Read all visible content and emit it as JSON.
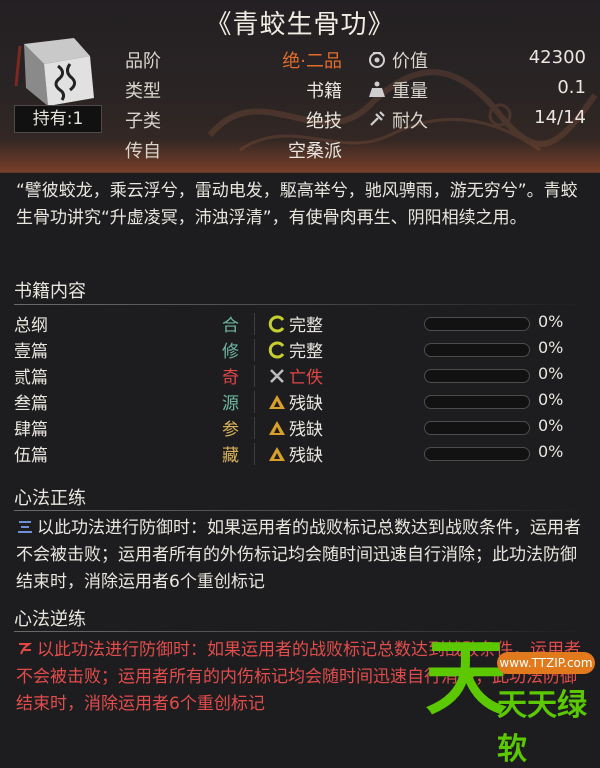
{
  "header": {
    "title": "《青蛟生骨功》",
    "owned_label": "持有:1",
    "attributes": [
      {
        "label": "品阶",
        "value": "绝·二品",
        "color": "#e26d2a"
      },
      {
        "label": "类型",
        "value": "书籍"
      },
      {
        "label": "子类",
        "value": "绝技"
      },
      {
        "label": "传自",
        "value": "空桑派"
      }
    ],
    "stats": [
      {
        "icon": "coin-bag-icon",
        "label": "价值",
        "value": "42300"
      },
      {
        "icon": "weight-icon",
        "label": "重量",
        "value": "0.1"
      },
      {
        "icon": "durability-icon",
        "label": "耐久",
        "value": "14/14"
      }
    ]
  },
  "description": "“譬彼蛟龙，乘云浮兮，雷动电发，駆高举兮，驰风骋雨，游无穷兮”。青蛟生骨功讲究“升虚凌冥，沛浊浮清”，有使骨肉再生、阴阳相续之用。",
  "contents": {
    "title": "书籍内容",
    "chapters": [
      {
        "name": "总纲",
        "key": "合",
        "status": "完整",
        "status_icon": "complete-ring-icon",
        "progress_text": "0%",
        "progress": 0
      },
      {
        "name": "壹篇",
        "key": "修",
        "status": "完整",
        "status_icon": "complete-ring-icon",
        "progress_text": "0%",
        "progress": 0
      },
      {
        "name": "贰篇",
        "key": "奇",
        "status": "亡佚",
        "status_icon": "lost-x-icon",
        "progress_text": "0%",
        "progress": 0
      },
      {
        "name": "叁篇",
        "key": "源",
        "status": "残缺",
        "status_icon": "damaged-triangle-icon",
        "progress_text": "0%",
        "progress": 0
      },
      {
        "name": "肆篇",
        "key": "参",
        "status": "残缺",
        "status_icon": "damaged-triangle-icon",
        "progress_text": "0%",
        "progress": 0
      },
      {
        "name": "伍篇",
        "key": "藏",
        "status": "残缺",
        "status_icon": "damaged-triangle-icon",
        "progress_text": "0%",
        "progress": 0
      }
    ]
  },
  "positive_practice": {
    "title": "心法正练",
    "text": "以此功法进行防御时：如果运用者的战败标记总数达到战败条件，运用者不会被击败；运用者所有的外伤标记均会随时间迅速自行消除；此功法防御结束时，消除运用者6个重创标记"
  },
  "reverse_practice": {
    "title": "心法逆练",
    "text": "以此功法进行防御时：如果运用者的战败标记总数达到战败条件，运用者不会被击败；运用者所有的内伤标记均会随时间迅速自行消除；此功法防御结束时，消除运用者6个重创标记"
  },
  "watermark": {
    "char": "天",
    "url": "www.TTZIP.com",
    "text": "天天绿软"
  },
  "colors": {
    "orange": "#e26d2a",
    "teal": "#6fb6a2",
    "red": "#e04848",
    "gold": "#d8b25a",
    "watermark_green": "#5bc800"
  }
}
